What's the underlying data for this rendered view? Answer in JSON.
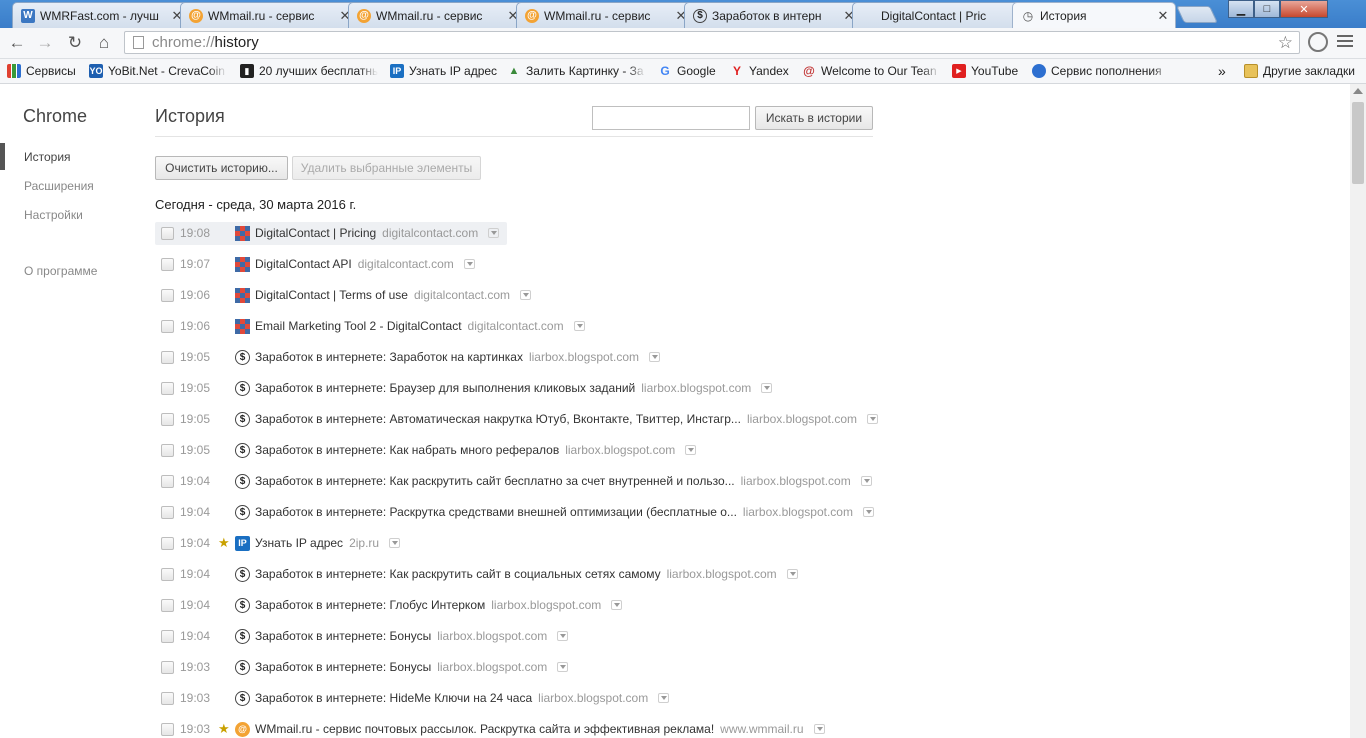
{
  "tabs": [
    {
      "title": "WMRFast.com - лучш",
      "icon": "w-letter-icon",
      "active": false
    },
    {
      "title": "WMmail.ru - сервис",
      "icon": "wmmail-icon",
      "active": false
    },
    {
      "title": "WMmail.ru - сервис",
      "icon": "wmmail-icon",
      "active": false
    },
    {
      "title": "WMmail.ru - сервис",
      "icon": "wmmail-icon",
      "active": false
    },
    {
      "title": "Заработок в интерн",
      "icon": "dollar-icon",
      "active": false
    },
    {
      "title": "DigitalContact | Pric",
      "icon": "digitalcontact-icon",
      "active": false
    },
    {
      "title": "История",
      "icon": "history-icon",
      "active": true
    }
  ],
  "window_controls": {
    "minimize": "▁",
    "maximize": "□",
    "close": "✕"
  },
  "omnibox": {
    "scheme": "chrome://",
    "path": "history"
  },
  "bookmarks": [
    {
      "label": "Сервисы",
      "icon": "apps-grid-icon"
    },
    {
      "label": "YoBit.Net - CrevaCoin",
      "icon": "yo-icon"
    },
    {
      "label": "20 лучших бесплатны",
      "icon": "film-icon"
    },
    {
      "label": "Узнать IP адрес",
      "icon": "ip-icon"
    },
    {
      "label": "Залить Картинку - За",
      "icon": "image-upload-icon"
    },
    {
      "label": "Google",
      "icon": "google-g-icon"
    },
    {
      "label": "Yandex",
      "icon": "yandex-y-icon"
    },
    {
      "label": "Welcome to Our Tean",
      "icon": "spiral-icon"
    },
    {
      "label": "YouTube",
      "icon": "youtube-icon"
    },
    {
      "label": "Сервис пополнения",
      "icon": "globe-icon"
    }
  ],
  "bookmarks_overflow": "»",
  "other_bookmarks": "Другие закладки",
  "sidebar": {
    "title": "Chrome",
    "items": [
      "История",
      "Расширения",
      "Настройки",
      "О программе"
    ]
  },
  "page": {
    "title": "История",
    "search_button": "Искать в истории",
    "clear_button": "Очистить историю...",
    "remove_button": "Удалить выбранные элементы",
    "date_header": "Сегодня - среда, 30 марта 2016 г."
  },
  "entries": [
    {
      "time": "19:08",
      "title": "DigitalContact | Pricing",
      "domain": "digitalcontact.com",
      "icon": "digitalcontact-icon",
      "starred": false
    },
    {
      "time": "19:07",
      "title": "DigitalContact API",
      "domain": "digitalcontact.com",
      "icon": "digitalcontact-icon",
      "starred": false
    },
    {
      "time": "19:06",
      "title": "DigitalContact | Terms of use",
      "domain": "digitalcontact.com",
      "icon": "digitalcontact-icon",
      "starred": false
    },
    {
      "time": "19:06",
      "title": "Email Marketing Tool 2 - DigitalContact",
      "domain": "digitalcontact.com",
      "icon": "digitalcontact-icon",
      "starred": false
    },
    {
      "time": "19:05",
      "title": "Заработок в интернете: Заработок на картинках",
      "domain": "liarbox.blogspot.com",
      "icon": "dollar-icon",
      "starred": false
    },
    {
      "time": "19:05",
      "title": "Заработок в интернете: Браузер для выполнения кликовых заданий",
      "domain": "liarbox.blogspot.com",
      "icon": "dollar-icon",
      "starred": false
    },
    {
      "time": "19:05",
      "title": "Заработок в интернете: Автоматическая накрутка Ютуб, Вконтакте, Твиттер, Инстагр...",
      "domain": "liarbox.blogspot.com",
      "icon": "dollar-icon",
      "starred": false
    },
    {
      "time": "19:05",
      "title": "Заработок в интернете: Как набрать много рефералов",
      "domain": "liarbox.blogspot.com",
      "icon": "dollar-icon",
      "starred": false
    },
    {
      "time": "19:04",
      "title": "Заработок в интернете: Как раскрутить сайт бесплатно за счет внутренней и пользо...",
      "domain": "liarbox.blogspot.com",
      "icon": "dollar-icon",
      "starred": false
    },
    {
      "time": "19:04",
      "title": "Заработок в интернете: Раскрутка средствами внешней оптимизации (бесплатные о...",
      "domain": "liarbox.blogspot.com",
      "icon": "dollar-icon",
      "starred": false
    },
    {
      "time": "19:04",
      "title": "Узнать IP адрес",
      "domain": "2ip.ru",
      "icon": "ip-icon",
      "starred": true
    },
    {
      "time": "19:04",
      "title": "Заработок в интернете: Как раскрутить сайт в социальных сетях самому",
      "domain": "liarbox.blogspot.com",
      "icon": "dollar-icon",
      "starred": false
    },
    {
      "time": "19:04",
      "title": "Заработок в интернете: Глобус Интерком",
      "domain": "liarbox.blogspot.com",
      "icon": "dollar-icon",
      "starred": false
    },
    {
      "time": "19:04",
      "title": "Заработок в интернете: Бонусы",
      "domain": "liarbox.blogspot.com",
      "icon": "dollar-icon",
      "starred": false
    },
    {
      "time": "19:03",
      "title": "Заработок в интернете: Бонусы",
      "domain": "liarbox.blogspot.com",
      "icon": "dollar-icon",
      "starred": false
    },
    {
      "time": "19:03",
      "title": "Заработок в интернете: HideMe Ключи на 24 часа",
      "domain": "liarbox.blogspot.com",
      "icon": "dollar-icon",
      "starred": false
    },
    {
      "time": "19:03",
      "title": "WMmail.ru - сервис почтовых рассылок. Раскрутка сайта и эффективная реклама!",
      "domain": "www.wmmail.ru",
      "icon": "wmmail-icon",
      "starred": true
    }
  ],
  "colors": {
    "titlebar": "#3a7dc9",
    "close_button": "#c6482e",
    "accent_blue": "#1a6fc2",
    "muted_text": "#999999"
  }
}
